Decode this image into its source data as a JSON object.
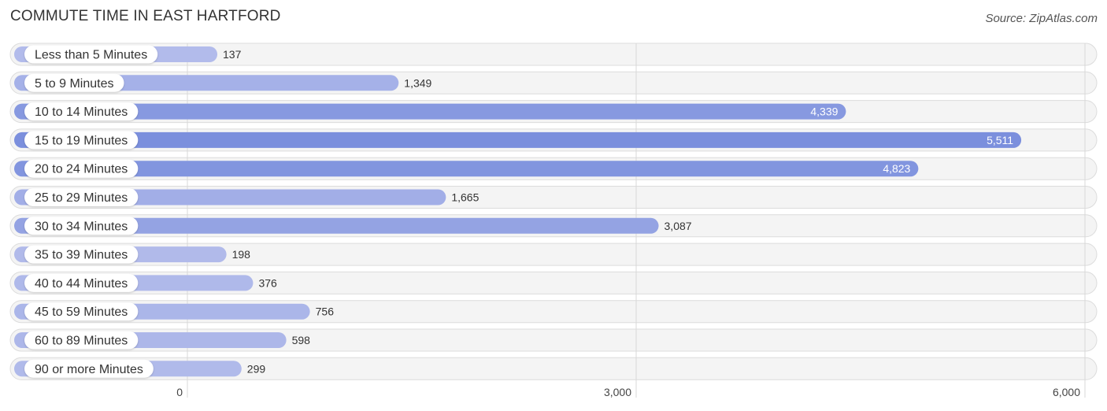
{
  "header": {
    "title": "COMMUTE TIME IN EAST HARTFORD",
    "source": "Source: ZipAtlas.com"
  },
  "chart_data": {
    "type": "bar",
    "orientation": "horizontal",
    "title": "COMMUTE TIME IN EAST HARTFORD",
    "xlabel": "",
    "ylabel": "",
    "categories": [
      "Less than 5 Minutes",
      "5 to 9 Minutes",
      "10 to 14 Minutes",
      "15 to 19 Minutes",
      "20 to 24 Minutes",
      "25 to 29 Minutes",
      "30 to 34 Minutes",
      "35 to 39 Minutes",
      "40 to 44 Minutes",
      "45 to 59 Minutes",
      "60 to 89 Minutes",
      "90 or more Minutes"
    ],
    "values": [
      137,
      1349,
      4339,
      5511,
      4823,
      1665,
      3087,
      198,
      376,
      756,
      598,
      299
    ],
    "value_labels": [
      "137",
      "1,349",
      "4,339",
      "5,511",
      "4,823",
      "1,665",
      "3,087",
      "198",
      "376",
      "756",
      "598",
      "299"
    ],
    "xlim": [
      0,
      6000
    ],
    "xticks": [
      0,
      3000,
      6000
    ],
    "xtick_labels": [
      "0",
      "3,000",
      "6,000"
    ],
    "grid": true,
    "legend": "none",
    "colors": {
      "bar_light": "#b3bceb",
      "bar_dark": "#7b8fdd",
      "row_bg": "#f4f4f4",
      "value_inside": "#ffffff",
      "value_outside": "#333333"
    }
  }
}
